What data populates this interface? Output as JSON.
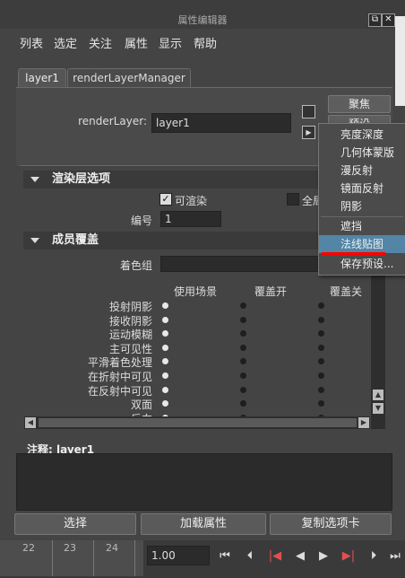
{
  "window": {
    "title": "属性编辑器",
    "float_icon": "⧉",
    "close_icon": "✕"
  },
  "menubar": [
    "列表",
    "选定",
    "关注",
    "属性",
    "显示",
    "帮助"
  ],
  "tabs": [
    {
      "label": "layer1",
      "active": true
    },
    {
      "label": "renderLayerManager",
      "active": false
    }
  ],
  "render_layer": {
    "label": "renderLayer:",
    "value": "layer1"
  },
  "side_buttons": {
    "focus": "聚焦",
    "preset": "预设"
  },
  "sections": {
    "render_layer_options": "渲染层选项",
    "member_overrides": "成员覆盖"
  },
  "options": {
    "renderable_label": "可渲染",
    "renderable_checked": true,
    "global_label": "全局",
    "number_label": "编号",
    "number_value": "1"
  },
  "member": {
    "shading_group_label": "着色组",
    "columns": [
      "使用场景",
      "覆盖开",
      "覆盖关"
    ],
    "rows": [
      "投射阴影",
      "接收阴影",
      "运动模糊",
      "主可见性",
      "平滑着色处理",
      "在折射中可见",
      "在反射中可见",
      "双面",
      "反向"
    ]
  },
  "context_menu": {
    "items": [
      "亮度深度",
      "几何体蒙版",
      "漫反射",
      "镜面反射",
      "阴影",
      "遮挡",
      "法线贴图",
      "保存预设..."
    ],
    "selected": "法线贴图"
  },
  "notes": {
    "label": "注释: layer1"
  },
  "bottom_buttons": [
    "选择",
    "加载属性",
    "复制选项卡"
  ],
  "timeline": {
    "ticks": [
      "22",
      "23",
      "24"
    ],
    "current_frame": "1.00"
  },
  "colors": {
    "menu_highlight": "#5285a6",
    "annotation_underline": "#ff0000"
  }
}
